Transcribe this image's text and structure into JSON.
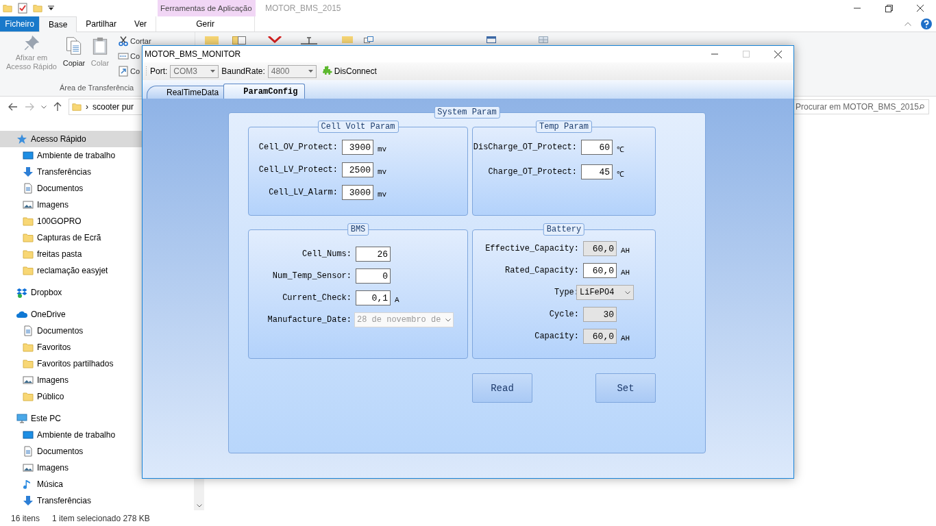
{
  "explorer": {
    "title": "MOTOR_BMS_2015",
    "context_header": "Ferramentas de Aplicação",
    "ribbon_tabs": [
      {
        "label": "Ficheiro",
        "kind": "file",
        "selected": false
      },
      {
        "label": "Base",
        "kind": "tab",
        "selected": true
      },
      {
        "label": "Partilhar",
        "kind": "tab",
        "selected": false
      },
      {
        "label": "Ver",
        "kind": "tab",
        "selected": false
      },
      {
        "label": "Gerir",
        "kind": "context",
        "selected": false
      }
    ],
    "ribbon": {
      "big_buttons": [
        {
          "label": "Afixar em Acesso Rápido",
          "kind": "pin",
          "disabled": true
        },
        {
          "label": "Copiar",
          "kind": "copy",
          "disabled": false
        },
        {
          "label": "Colar",
          "kind": "paste",
          "disabled": true
        }
      ],
      "small_buttons": [
        {
          "label": "Cortar",
          "kind": "cut"
        },
        {
          "label": "Co",
          "kind": "copy-path"
        },
        {
          "label": "Co",
          "kind": "shortcut"
        }
      ],
      "group_label": "Área de Transferência",
      "other_items": [
        {
          "kind": "folder"
        },
        {
          "kind": "move"
        },
        {
          "kind": "delete"
        },
        {
          "kind": "rename"
        },
        {
          "kind": "new-folder"
        },
        {
          "kind": "new"
        },
        {
          "kind": "open"
        },
        {
          "kind": "select"
        }
      ]
    },
    "address": {
      "separator": "›",
      "path": "scooter pur"
    },
    "search": {
      "placeholder": "Procurar em MOTOR_BMS_2015"
    },
    "sidebar": {
      "items": [
        {
          "label": "Acesso Rápido",
          "kind": "star",
          "selected": true,
          "children": [
            {
              "label": "Ambiente de trabalho",
              "kind": "desktop",
              "selected": false
            },
            {
              "label": "Transferências",
              "kind": "download",
              "selected": false
            },
            {
              "label": "Documentos",
              "kind": "document",
              "selected": false
            },
            {
              "label": "Imagens",
              "kind": "image",
              "selected": false
            },
            {
              "label": "100GOPRO",
              "kind": "folder",
              "selected": false
            },
            {
              "label": "Capturas de Ecrã",
              "kind": "folder",
              "selected": false
            },
            {
              "label": "freitas pasta",
              "kind": "folder",
              "selected": false
            },
            {
              "label": "reclamação easyjet",
              "kind": "folder",
              "selected": false
            }
          ]
        },
        {
          "label": "Dropbox",
          "kind": "dropbox",
          "selected": false
        },
        {
          "label": "OneDrive",
          "kind": "cloud",
          "selected": false,
          "children": [
            {
              "label": "Documentos",
              "kind": "document",
              "selected": false
            },
            {
              "label": "Favoritos",
              "kind": "folder",
              "selected": false
            },
            {
              "label": "Favoritos partilhados",
              "kind": "folder",
              "selected": false
            },
            {
              "label": "Imagens",
              "kind": "image",
              "selected": false
            },
            {
              "label": "Público",
              "kind": "folder",
              "selected": false
            }
          ]
        },
        {
          "label": "Este PC",
          "kind": "pc",
          "selected": false,
          "children": [
            {
              "label": "Ambiente de trabalho",
              "kind": "desktop",
              "selected": false
            },
            {
              "label": "Documentos",
              "kind": "document",
              "selected": false
            },
            {
              "label": "Imagens",
              "kind": "image",
              "selected": false
            },
            {
              "label": "Música",
              "kind": "music",
              "selected": false
            },
            {
              "label": "Transferências",
              "kind": "download",
              "selected": false
            }
          ]
        }
      ]
    },
    "status_bar": {
      "count": "16 itens",
      "selection": "1 item selecionado 278 KB"
    }
  },
  "dialog": {
    "title": "MOTOR_BMS_MONITOR",
    "toolbar": {
      "port_label": "Port:",
      "port": {
        "value": "COM3",
        "disabled": true
      },
      "baud_label": "BaundRate:",
      "baud": {
        "value": "4800",
        "disabled": true
      },
      "connect": "DisConnect"
    },
    "tabs": [
      {
        "label": "RealTimeData",
        "selected": false
      },
      {
        "label": "ParamConfig",
        "selected": true
      }
    ],
    "system_param": {
      "title": "System Param",
      "groups": [
        {
          "title": "Cell Volt Param",
          "fields": [
            {
              "label": "Cell_OV_Protect:",
              "kind": "input",
              "value": "3900",
              "unit": "mv",
              "disabled": false
            },
            {
              "label": "Cell_LV_Protect:",
              "kind": "input",
              "value": "2500",
              "unit": "mv",
              "disabled": false
            },
            {
              "label": "Cell_LV_Alarm:",
              "kind": "input",
              "value": "3000",
              "unit": "mv",
              "disabled": false
            }
          ]
        },
        {
          "title": "Temp Param",
          "fields": [
            {
              "label": "DisCharge_OT_Protect:",
              "kind": "input",
              "value": "60",
              "unit": "℃",
              "disabled": false
            },
            {
              "label": "Charge_OT_Protect:",
              "kind": "input",
              "value": "45",
              "unit": "℃",
              "disabled": false
            }
          ]
        },
        {
          "title": "BMS",
          "fields": [
            {
              "label": "Cell_Nums:",
              "kind": "input",
              "value": "26",
              "disabled": false
            },
            {
              "label": "Num_Temp_Sensor:",
              "kind": "input",
              "value": "0",
              "disabled": false
            },
            {
              "label": "Current_Check:",
              "kind": "input",
              "value": "0,1",
              "unit": "A",
              "disabled": false
            },
            {
              "label": "Manufacture_Date:",
              "kind": "date",
              "value": "28 de novembro de",
              "disabled": true
            }
          ]
        },
        {
          "title": "Battery",
          "fields": [
            {
              "label": "Effective_Capacity:",
              "kind": "input",
              "value": "60,0",
              "unit": "AH",
              "disabled": true
            },
            {
              "label": "Rated_Capacity:",
              "kind": "input",
              "value": "60,0",
              "unit": "AH",
              "disabled": false
            },
            {
              "label": "Type:",
              "kind": "select",
              "value": "LiFePO4",
              "disabled": false
            },
            {
              "label": "Cycle:",
              "kind": "input",
              "value": "30",
              "disabled": true
            },
            {
              "label": "Capacity:",
              "kind": "input",
              "value": "60,0",
              "unit": "AH",
              "disabled": true
            }
          ]
        }
      ]
    },
    "buttons": [
      "Read",
      "Set"
    ]
  }
}
